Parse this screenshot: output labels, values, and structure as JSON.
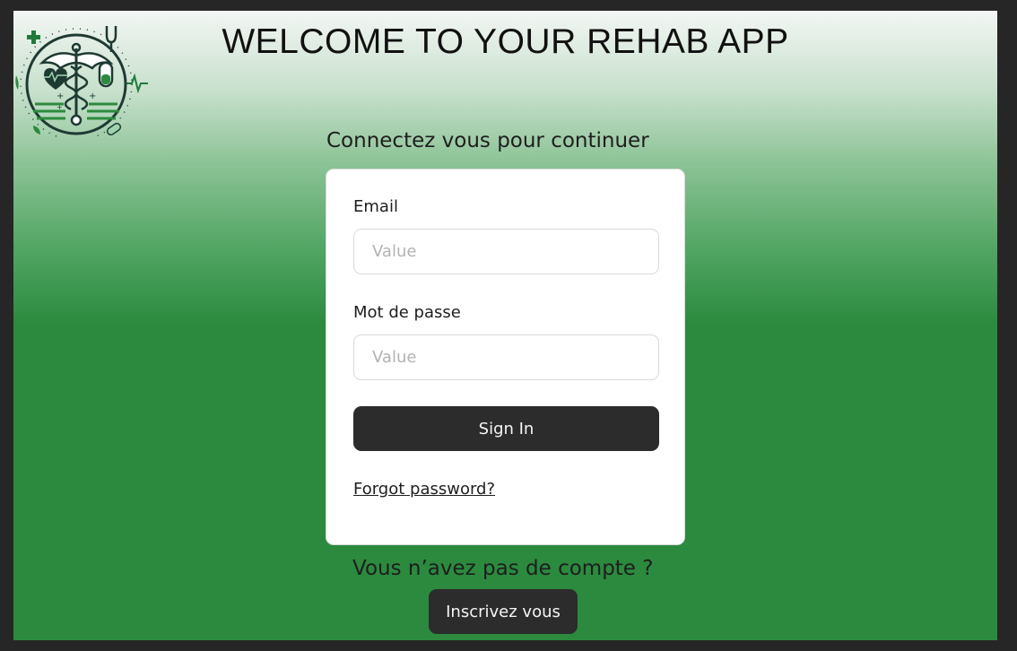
{
  "header": {
    "title": "WELCOME TO YOUR REHAB APP",
    "logo_icon": "medical-caduceus-logo"
  },
  "login": {
    "subtitle": "Connectez vous pour continuer",
    "email_label": "Email",
    "email_placeholder": "Value",
    "password_label": "Mot de passe",
    "password_placeholder": "Value",
    "signin_label": "Sign In",
    "forgot_label": "Forgot password?"
  },
  "register": {
    "prompt": "Vous n’avez pas de compte ?",
    "button_label": "Inscrivez vous"
  },
  "colors": {
    "primary_green": "#2b8a3e",
    "button_dark": "#2c2c2c",
    "logo_green": "#1f7a3a",
    "logo_dark": "#1e3a32"
  }
}
